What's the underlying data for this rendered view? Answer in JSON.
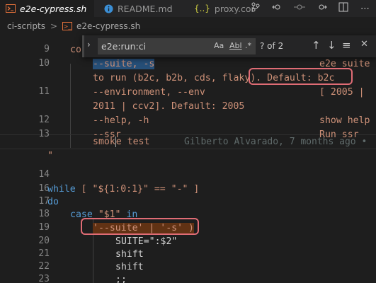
{
  "tabs": [
    {
      "label": "e2e-cypress.sh",
      "icon": "shell-script-icon",
      "active": true,
      "close": "✕"
    },
    {
      "label": "README.md",
      "icon": "info-icon",
      "active": false
    },
    {
      "label": "proxy.conf.",
      "icon": "json-braces-icon",
      "active": false
    }
  ],
  "editor_actions": [
    "source-control-icon",
    "go-back-icon",
    "timeline-icon",
    "go-forward-icon",
    "split-editor-icon",
    "more-icon"
  ],
  "breadcrumb": {
    "folder": "ci-scripts",
    "separator": ">",
    "file": "e2e-cypress.sh"
  },
  "find_widget": {
    "value": "e2e:run:ci",
    "match_case": "Aa",
    "whole_word": "Abl",
    "regex": ".*",
    "count": "? of 2"
  },
  "lines": [
    {
      "num": "9",
      "text": "co"
    },
    {
      "num": "10",
      "text": "--suite, -s",
      "right": "e2e suite"
    },
    {
      "num": "",
      "text_a": "to run (b2c, b2b, cds, flaky",
      "text_b": "). Default: b2c"
    },
    {
      "num": "11",
      "text": "--environment, --env",
      "right": "[ 2005 |"
    },
    {
      "num": "",
      "text": "2011 | ccv2]. Default: 2005"
    },
    {
      "num": "12",
      "text": "--help, -h",
      "right": "show help"
    },
    {
      "num": "13",
      "text": "--ssr",
      "right": "Run ssr"
    },
    {
      "num": "",
      "text_a": "smok",
      "text_b": "e",
      "text_c": " test",
      "blame": "Gilberto Alvarado, 7 months ago •"
    },
    {
      "num": "",
      "text": "\""
    },
    {
      "num": "14",
      "text": ""
    },
    {
      "num": "16",
      "kw": "while",
      "text": " [ \"${1:0:1}\" == \"-\" ]"
    },
    {
      "num": "17",
      "kw": "do"
    },
    {
      "num": "18",
      "kw": "case",
      "text_a": " \"$1\" ",
      "kw2": "in"
    },
    {
      "num": "19",
      "text": "'--suite' | '-s' )"
    },
    {
      "num": "20",
      "text": "SUITE=\":$2\""
    },
    {
      "num": "21",
      "text": "shift"
    },
    {
      "num": "22",
      "text": "shift"
    },
    {
      "num": "23",
      "text": ";;"
    }
  ]
}
